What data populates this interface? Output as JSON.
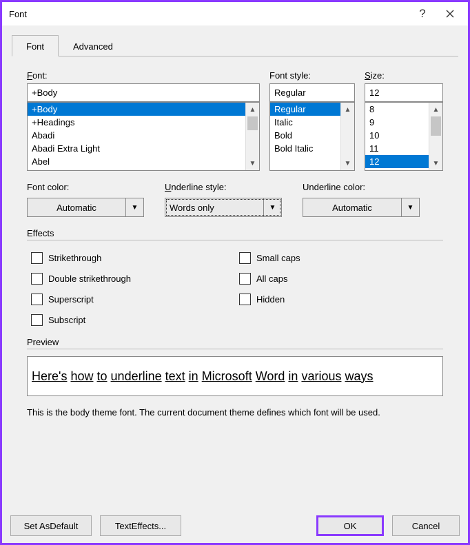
{
  "title": "Font",
  "tabs": {
    "font": "Font",
    "advanced": "Advanced"
  },
  "labels": {
    "font": "Font:",
    "style": "Font style:",
    "size": "Size:",
    "color": "Font color:",
    "ustyle": "Underline style:",
    "ucolor": "Underline color:",
    "effects": "Effects",
    "preview": "Preview"
  },
  "font": {
    "value": "+Body",
    "items": [
      "+Body",
      "+Headings",
      "Abadi",
      "Abadi Extra Light",
      "Abel"
    ]
  },
  "style": {
    "value": "Regular",
    "items": [
      "Regular",
      "Italic",
      "Bold",
      "Bold Italic"
    ]
  },
  "size": {
    "value": "12",
    "items": [
      "8",
      "9",
      "10",
      "11",
      "12"
    ]
  },
  "color": {
    "value": "Automatic"
  },
  "ustyle": {
    "value": "Words only"
  },
  "ucolor": {
    "value": "Automatic"
  },
  "effects": {
    "strike": "Strikethrough",
    "dstrike": "Double strikethrough",
    "super": "Superscript",
    "sub": "Subscript",
    "smallcaps": "Small caps",
    "allcaps": "All caps",
    "hidden": "Hidden"
  },
  "previewWords": [
    "Here's",
    "how",
    "to",
    "underline",
    "text",
    "in",
    "Microsoft",
    "Word",
    "in",
    "various",
    "ways"
  ],
  "desc": "This is the body theme font. The current document theme defines which font will be used.",
  "buttons": {
    "default": "Set As Default",
    "effects": "Text Effects...",
    "ok": "OK",
    "cancel": "Cancel"
  }
}
